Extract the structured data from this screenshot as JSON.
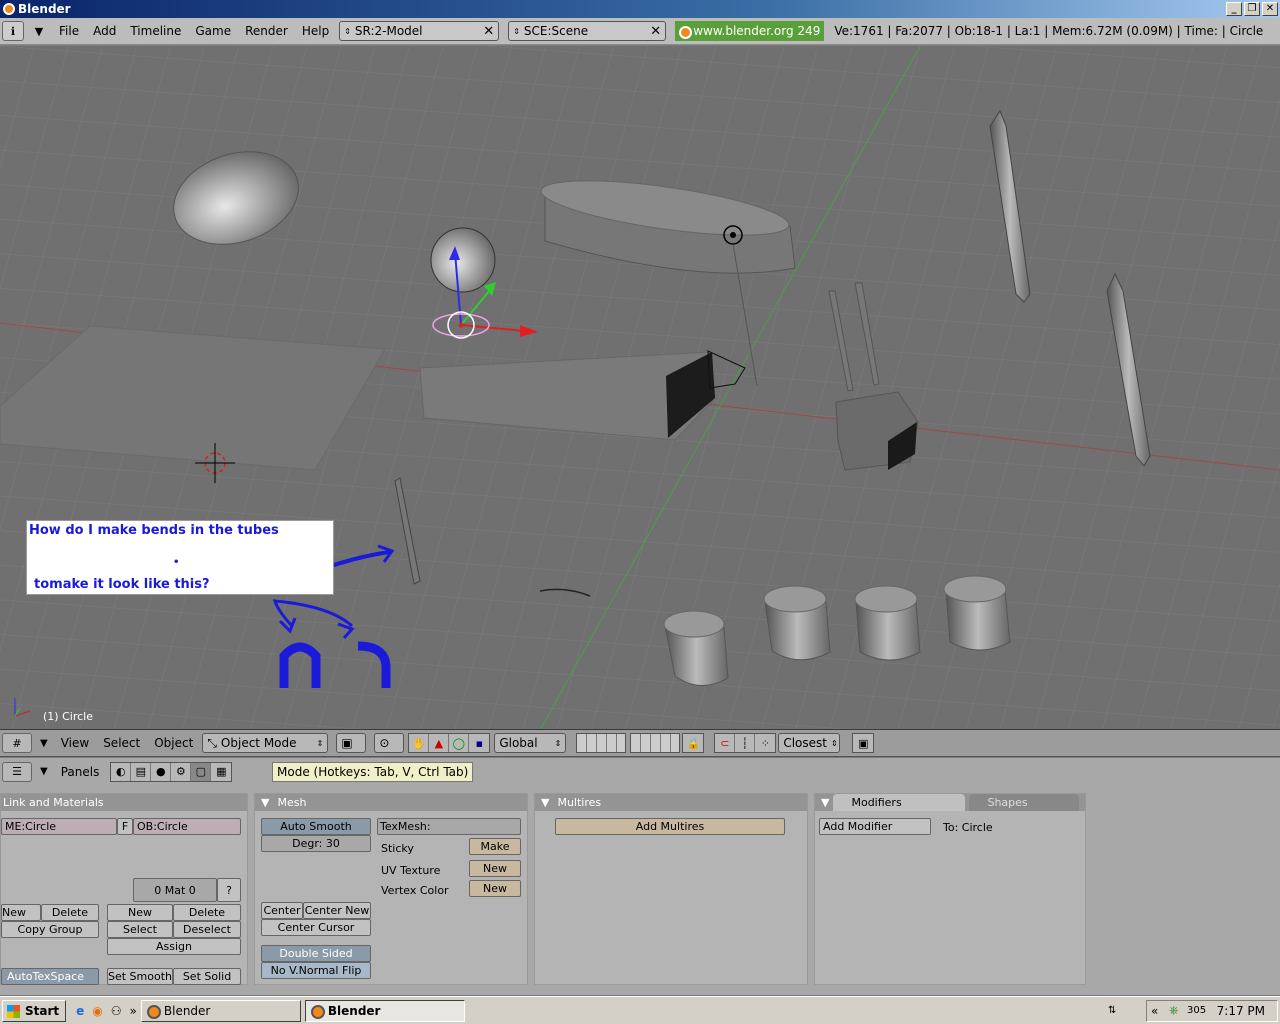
{
  "window": {
    "title": "Blender"
  },
  "menu": {
    "items": [
      "File",
      "Add",
      "Timeline",
      "Game",
      "Render",
      "Help"
    ]
  },
  "screen": {
    "label": "SR:2-Model"
  },
  "scene": {
    "label": "SCE:Scene"
  },
  "info": {
    "url": "www.blender.org 249",
    "stats": "Ve:1761 | Fa:2077 | Ob:18-1 | La:1  | Mem:6.72M (0.09M)  | Time: | Circle"
  },
  "viewport": {
    "object_label": "(1) Circle",
    "note_line1": "How do I make bends in the tubes",
    "note_line2": "tomake it look like this?"
  },
  "view3d_header": {
    "menus": [
      "View",
      "Select",
      "Object"
    ],
    "mode": "Object Mode",
    "orientation": "Global",
    "snap": "Closest"
  },
  "buttons_header": {
    "panels_label": "Panels",
    "tooltip": "Mode (Hotkeys: Tab, V, Ctrl Tab)"
  },
  "link_materials": {
    "title": "Link and Materials",
    "mesh_name": "ME:Circle",
    "f_button": "F",
    "object_name": "OB:Circle",
    "mat_counter": "0 Mat 0",
    "question": "?",
    "new_group": "New",
    "delete_group": "Delete",
    "copy_group": "Copy Group",
    "new_mat": "New",
    "delete_mat": "Delete",
    "select": "Select",
    "deselect": "Deselect",
    "assign": "Assign",
    "autotexspace": "AutoTexSpace",
    "set_smooth": "Set Smooth",
    "set_solid": "Set Solid"
  },
  "mesh": {
    "title": "Mesh",
    "auto_smooth": "Auto Smooth",
    "degr": "Degr: 30",
    "texmesh": "TexMesh:",
    "sticky": "Sticky",
    "make": "Make",
    "uv_texture": "UV Texture",
    "uv_new": "New",
    "vertex_color": "Vertex Color",
    "vc_new": "New",
    "center": "Center",
    "center_new": "Center New",
    "center_cursor": "Center Cursor",
    "double_sided": "Double Sided",
    "no_vnormal_flip": "No V.Normal Flip"
  },
  "multires": {
    "title": "Multires",
    "add_multires": "Add Multires"
  },
  "modifiers": {
    "tab_modifiers": "Modifiers",
    "tab_shapes": "Shapes",
    "add_modifier": "Add Modifier",
    "to": "To: Circle"
  },
  "taskbar": {
    "start": "Start",
    "tasks": [
      "Blender",
      "Blender"
    ],
    "tray_number": "305",
    "clock": "7:17 PM"
  }
}
